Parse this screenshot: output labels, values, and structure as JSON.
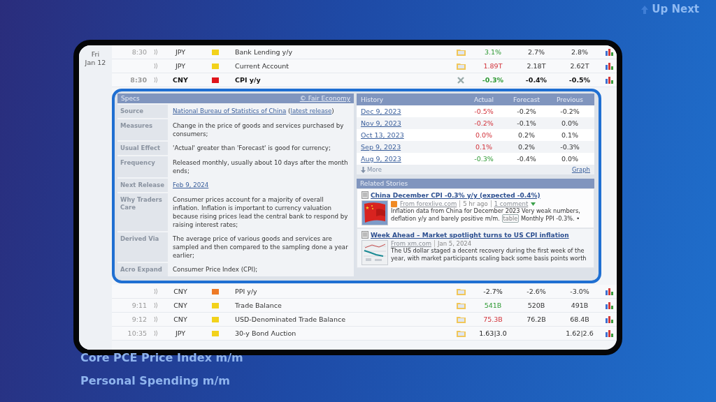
{
  "background": {
    "up_next": "Up Next",
    "items": [
      "Core PCE Price Index m/m",
      "Personal Spending m/m"
    ]
  },
  "calendar": {
    "day": "Fri",
    "date": "Jan 12",
    "rows": [
      {
        "time": "8:30",
        "currency": "JPY",
        "color": "#f2d21b",
        "event": "Bank Lending y/y",
        "expanded": false,
        "actual": {
          "text": "3.1%",
          "kind": "better"
        },
        "forecast": "2.7%",
        "previous": "2.8%"
      },
      {
        "currency": "JPY",
        "color": "#f2d21b",
        "event": "Current Account",
        "expanded": false,
        "actual": {
          "text": "1.89T",
          "kind": "worse"
        },
        "forecast": "2.18T",
        "previous": "2.62T"
      },
      {
        "time": "8:30",
        "currency": "CNY",
        "color": "#e0151b",
        "event": "CPI y/y",
        "expanded": true,
        "actual": {
          "text": "-0.3%",
          "kind": "better"
        },
        "forecast": "-0.4%",
        "previous": "-0.5%"
      },
      {
        "currency": "CNY",
        "color": "#ee7a26",
        "event": "PPI y/y",
        "expanded": false,
        "actual": {
          "text": "-2.7%",
          "kind": "neutral"
        },
        "forecast": "-2.6%",
        "previous": "-3.0%"
      },
      {
        "time": "9:11",
        "currency": "CNY",
        "color": "#f2d21b",
        "event": "Trade Balance",
        "expanded": false,
        "actual": {
          "text": "541B",
          "kind": "better"
        },
        "forecast": "520B",
        "previous": "491B"
      },
      {
        "time": "9:12",
        "currency": "CNY",
        "color": "#f2d21b",
        "event": "USD-Denominated Trade Balance",
        "expanded": false,
        "actual": {
          "text": "75.3B",
          "kind": "worse"
        },
        "forecast": "76.2B",
        "previous": "68.4B"
      },
      {
        "time": "10:35",
        "currency": "JPY",
        "color": "#f2d21b",
        "event": "30-y Bond Auction",
        "expanded": false,
        "actual": {
          "text": "1.63|3.0",
          "kind": "neutral"
        },
        "previous": "1.62|2.6"
      }
    ]
  },
  "specs": {
    "title": "Specs",
    "credit": "© Fair Economy",
    "rows": [
      {
        "label": "Source",
        "value": [
          {
            "text": "National Bureau of Statistics of China",
            "kind": "link"
          },
          {
            "text": " (",
            "kind": "text"
          },
          {
            "text": "latest release",
            "kind": "link"
          },
          {
            "text": ")",
            "kind": "text"
          }
        ]
      },
      {
        "label": "Measures",
        "value": [
          {
            "text": "Change in the price of goods and services purchased by consumers;",
            "kind": "text"
          }
        ]
      },
      {
        "label": "Usual Effect",
        "value": [
          {
            "text": "'Actual' greater than 'Forecast' is good for currency;",
            "kind": "text"
          }
        ]
      },
      {
        "label": "Frequency",
        "value": [
          {
            "text": "Released monthly, usually about 10 days after the month ends;",
            "kind": "text"
          }
        ]
      },
      {
        "label": "Next Release",
        "value": [
          {
            "text": "Feb 9, 2024",
            "kind": "link"
          }
        ]
      },
      {
        "label": "Why Traders Care",
        "value": [
          {
            "text": "Consumer prices account for a majority of overall inflation. Inflation is important to currency valuation because rising prices lead the central bank to respond by raising interest rates;",
            "kind": "text"
          }
        ]
      },
      {
        "label": "Derived Via",
        "value": [
          {
            "text": "The average price of various goods and services are sampled and then compared to the sampling done a year earlier;",
            "kind": "text"
          }
        ]
      },
      {
        "label": "Acro Expand",
        "value": [
          {
            "text": "Consumer Price Index (CPI);",
            "kind": "text"
          }
        ]
      }
    ]
  },
  "history": {
    "columns": [
      "History",
      "Actual",
      "Forecast",
      "Previous"
    ],
    "rows": [
      {
        "date": "Dec 9, 2023",
        "actual": {
          "text": "-0.5%",
          "kind": "worse"
        },
        "forecast": "-0.2%",
        "previous": "-0.2%"
      },
      {
        "date": "Nov 9, 2023",
        "actual": {
          "text": "-0.2%",
          "kind": "worse"
        },
        "forecast": "-0.1%",
        "previous": "0.0%"
      },
      {
        "date": "Oct 13, 2023",
        "actual": {
          "text": "0.0%",
          "kind": "worse"
        },
        "forecast": "0.2%",
        "previous": "0.1%"
      },
      {
        "date": "Sep 9, 2023",
        "actual": {
          "text": "0.1%",
          "kind": "worse"
        },
        "forecast": "0.2%",
        "previous": "-0.3%"
      },
      {
        "date": "Aug 9, 2023",
        "actual": {
          "text": "-0.3%",
          "kind": "better"
        },
        "forecast": "-0.4%",
        "previous": "0.0%"
      }
    ],
    "more": "More",
    "graph": "Graph"
  },
  "related": {
    "title": "Related Stories",
    "stories": [
      {
        "headline": "China December CPI -0.3% y/y (expected -0.4%)",
        "feed_icon": true,
        "source": "From forexlive.com",
        "time": "5 hr ago",
        "comments": "1 comment",
        "summary": [
          {
            "text": "Inflation data from China for December 2023 Very weak numbers, deflation y/y and barely positive m/m. ",
            "kind": "text"
          },
          {
            "text": "table",
            "kind": "tag"
          },
          {
            "text": " Monthly PPI -0.3%. •",
            "kind": "text"
          }
        ]
      },
      {
        "headline": "Week Ahead – Market spotlight turns to US CPI inflation",
        "feed_icon": false,
        "source": "From xm.com",
        "time": "Jan 5, 2024",
        "summary": [
          {
            "text": "The US dollar staged a decent recovery during the first week of the year, with market participants scaling back some basis points worth",
            "kind": "text"
          }
        ]
      }
    ]
  }
}
